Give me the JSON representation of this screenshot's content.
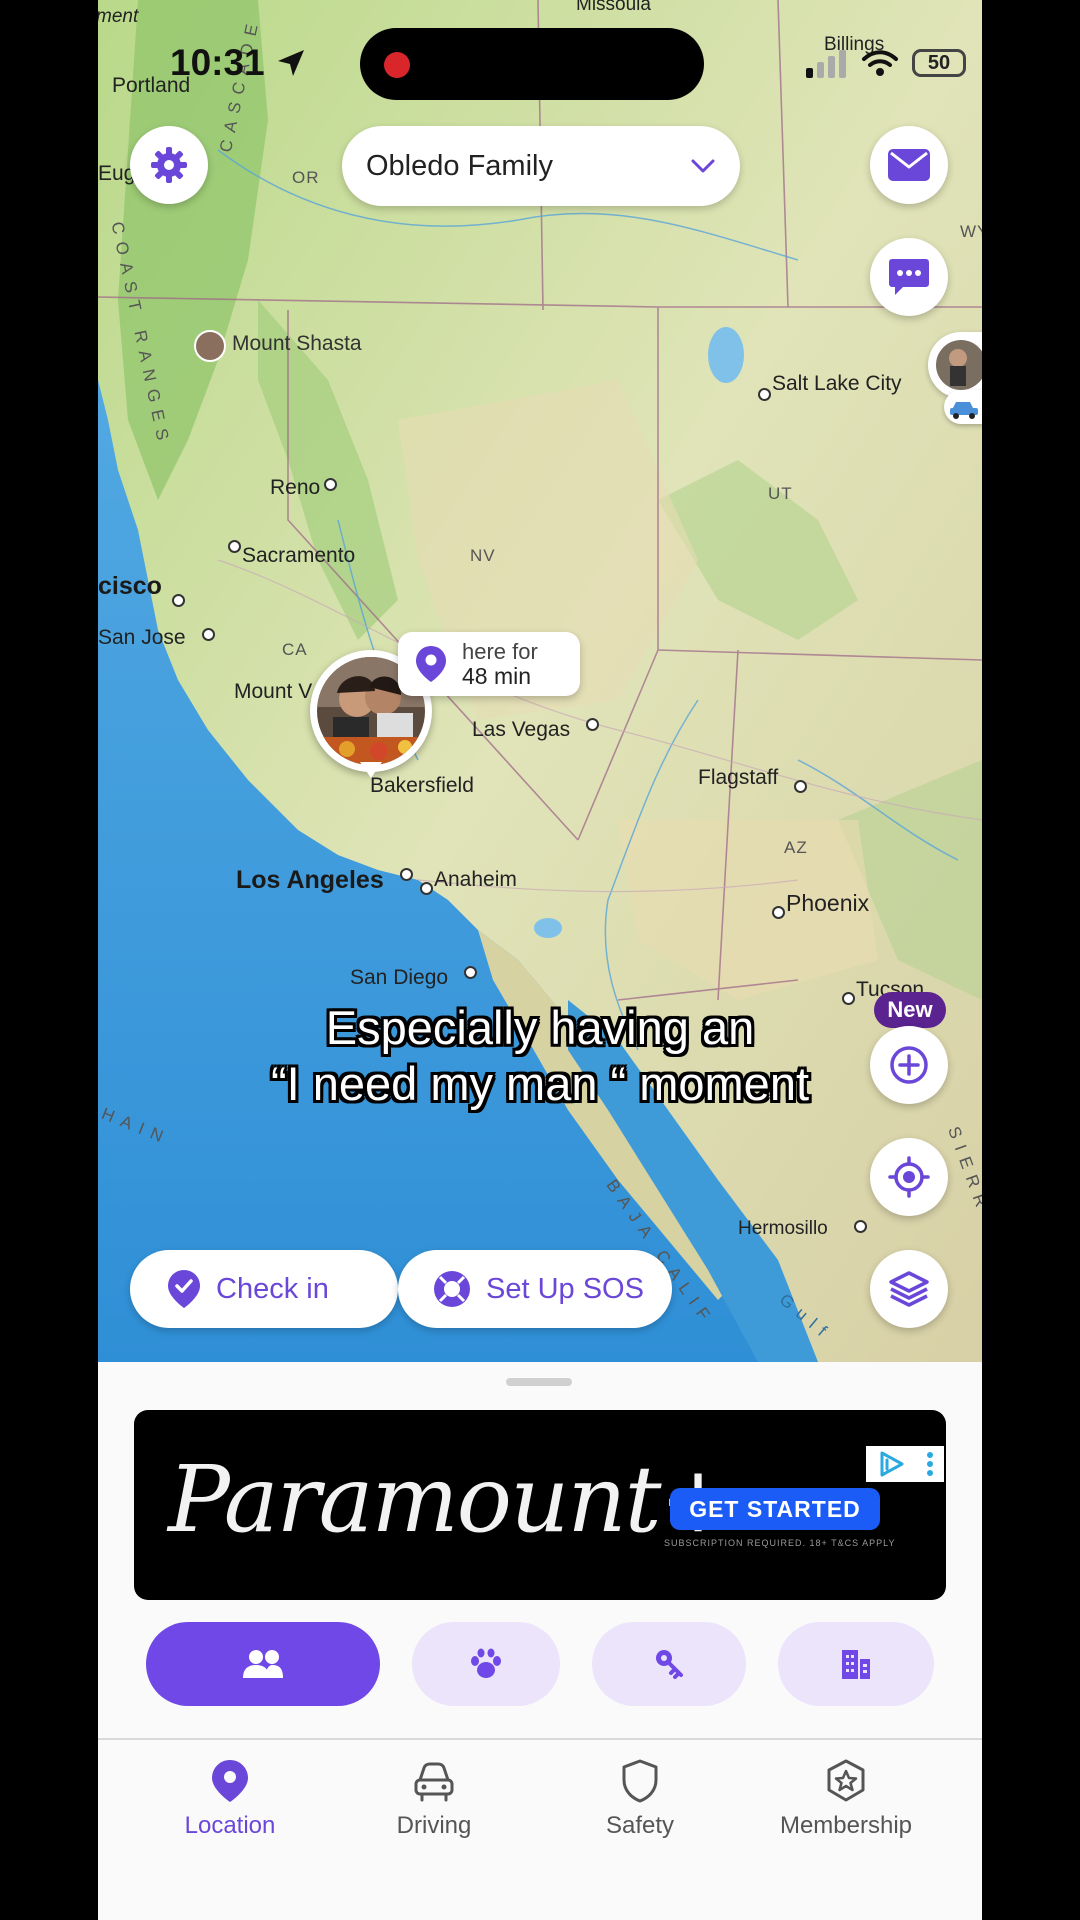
{
  "status_bar": {
    "time": "10:31",
    "battery": "50"
  },
  "header": {
    "circle_name": "Obledo Family"
  },
  "map": {
    "labels": {
      "missoula": "Missoula",
      "billings": "Billings",
      "portland": "Portland",
      "eugene": "Eug",
      "oregon": "OR",
      "wy": "WY",
      "cascade": "CASCADE",
      "mount_shasta": "Mount Shasta",
      "salt_lake_city": "Salt Lake City",
      "coast_ranges": "COAST RANGES",
      "reno": "Reno",
      "ut": "UT",
      "sacramento": "Sacramento",
      "nv": "NV",
      "san_francisco": "cisco",
      "san_jose": "San Jose",
      "ca": "CA",
      "mount_whitney": "Mount V",
      "las_vegas": "Las Vegas",
      "bakersfield": "Bakersfield",
      "flagstaff": "Flagstaff",
      "az": "AZ",
      "los_angeles": "Los Angeles",
      "anaheim": "Anaheim",
      "phoenix": "Phoenix",
      "san_diego": "San Diego",
      "tucson": "Tucson",
      "hermosillo": "Hermosillo",
      "gulf": "Gulf",
      "baja": "BAJA CALIF",
      "chain": "HAIN",
      "sierra": "SIERR",
      "sacramento_top": "ment"
    },
    "here_for_line1": "here for",
    "here_for_line2": "48 min"
  },
  "caption": {
    "line1": "Especially having an",
    "line2": "“I need my man “ moment"
  },
  "badges": {
    "new": "New"
  },
  "actions": {
    "check_in": "Check in",
    "sos": "Set Up SOS"
  },
  "ad": {
    "brand": "Paramount+",
    "cta": "GET STARTED",
    "fine_print": "SUBSCRIPTION REQUIRED. 18+ T&CS APPLY"
  },
  "tabs": [
    "people",
    "pets",
    "items",
    "places"
  ],
  "nav": {
    "location": "Location",
    "driving": "Driving",
    "safety": "Safety",
    "membership": "Membership"
  },
  "colors": {
    "accent": "#6a47d8",
    "accent_light": "#ebe4fb",
    "ocean": "#3f9bd8",
    "land": "#cfe0a8",
    "badge": "#5a2390"
  }
}
